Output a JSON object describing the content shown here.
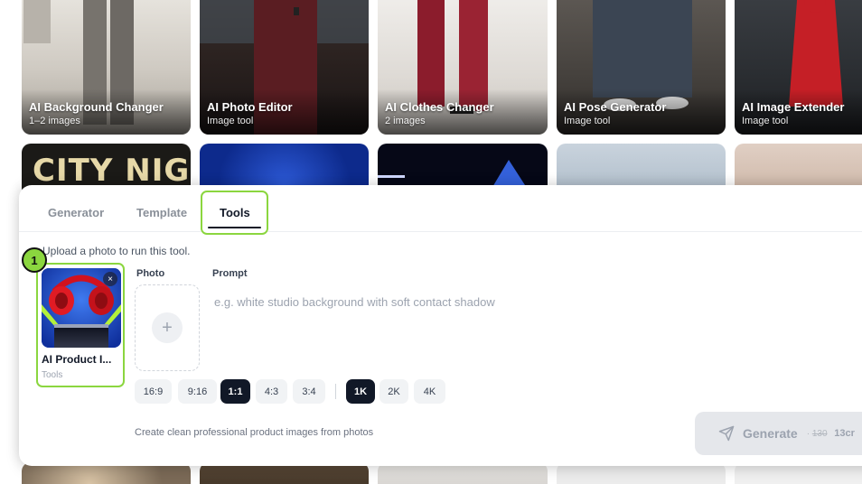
{
  "gallery": {
    "cards": [
      {
        "title": "AI Background Changer",
        "subtitle": "1–2 images"
      },
      {
        "title": "AI Photo Editor",
        "subtitle": "Image tool"
      },
      {
        "title": "AI Clothes Changer",
        "subtitle": "2 images"
      },
      {
        "title": "AI Pose Generator",
        "subtitle": "Image tool"
      },
      {
        "title": "AI Image Extender",
        "subtitle": "Image tool"
      }
    ],
    "poster_text": "CITY NIGHTS"
  },
  "panel": {
    "tabs": [
      {
        "label": "Generator"
      },
      {
        "label": "Template"
      },
      {
        "label": "Tools"
      }
    ],
    "active_tab": "Tools",
    "hint": "Upload a photo to run this tool.",
    "step_badge": "1",
    "selected_tool": {
      "name": "AI Product I...",
      "category": "Tools",
      "close_icon": "×"
    },
    "photo_label": "Photo",
    "prompt_label": "Prompt",
    "prompt_placeholder": "e.g. white studio background with soft contact shadow",
    "plus_icon": "+",
    "aspect_ratios": [
      "16:9",
      "9:16",
      "1:1",
      "4:3",
      "3:4"
    ],
    "selected_aspect": "1:1",
    "resolutions": [
      "1K",
      "2K",
      "4K"
    ],
    "selected_resolution": "1K",
    "footer_note": "Create clean professional product images from photos",
    "generate": {
      "label": "Generate",
      "dot": "·",
      "old_price": "130",
      "new_price": "13cr"
    }
  },
  "colors": {
    "accent": "#8bd63f",
    "dark": "#111827"
  }
}
